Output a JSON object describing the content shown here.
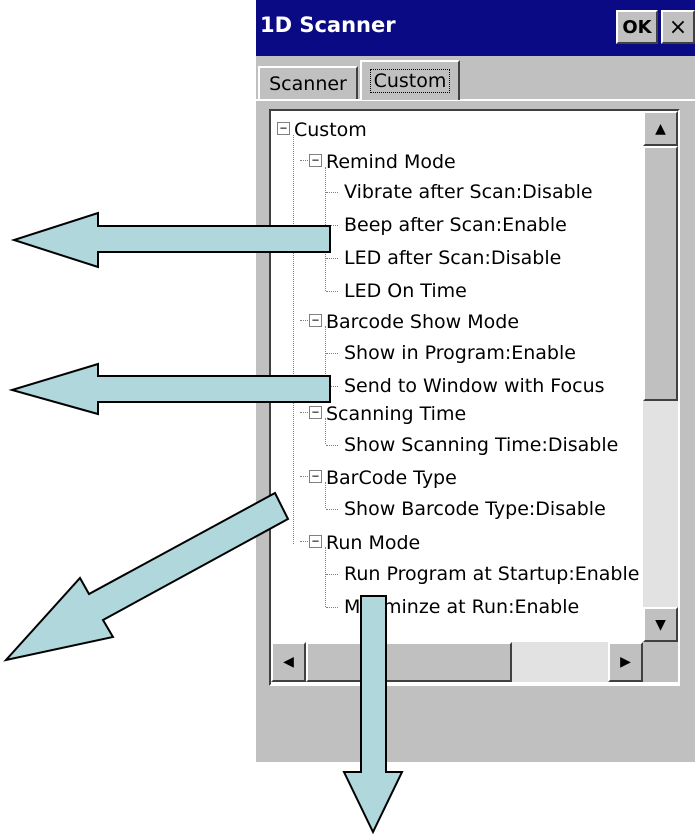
{
  "window": {
    "title": "1D Scanner",
    "ok_label": "OK",
    "close_glyph": "×"
  },
  "tabs": [
    {
      "label": "Scanner",
      "active": false
    },
    {
      "label": "Custom",
      "active": true
    }
  ],
  "tree": {
    "root": "Custom",
    "groups": [
      {
        "label": "Remind Mode",
        "items": [
          "Vibrate after Scan:Disable",
          "Beep after Scan:Enable",
          "LED after Scan:Disable",
          "LED On Time"
        ]
      },
      {
        "label": "Barcode Show Mode",
        "items": [
          "Show in Program:Enable",
          "Send to Window with Focus"
        ]
      },
      {
        "label": "Scanning Time",
        "items": [
          "Show Scanning Time:Disable"
        ]
      },
      {
        "label": "BarCode Type",
        "items": [
          "Show Barcode Type:Disable"
        ]
      },
      {
        "label": "Run Mode",
        "items": [
          "Run Program at Startup:Enable",
          "Miniminze at Run:Enable"
        ]
      }
    ]
  },
  "scrollbars": {
    "up_icon": "▲",
    "down_icon": "▼",
    "left_icon": "◀",
    "right_icon": "▶"
  },
  "colors": {
    "titlebar": "#0a0a84",
    "face": "#c0c0c0",
    "arrow_fill": "#b0d8dc"
  }
}
